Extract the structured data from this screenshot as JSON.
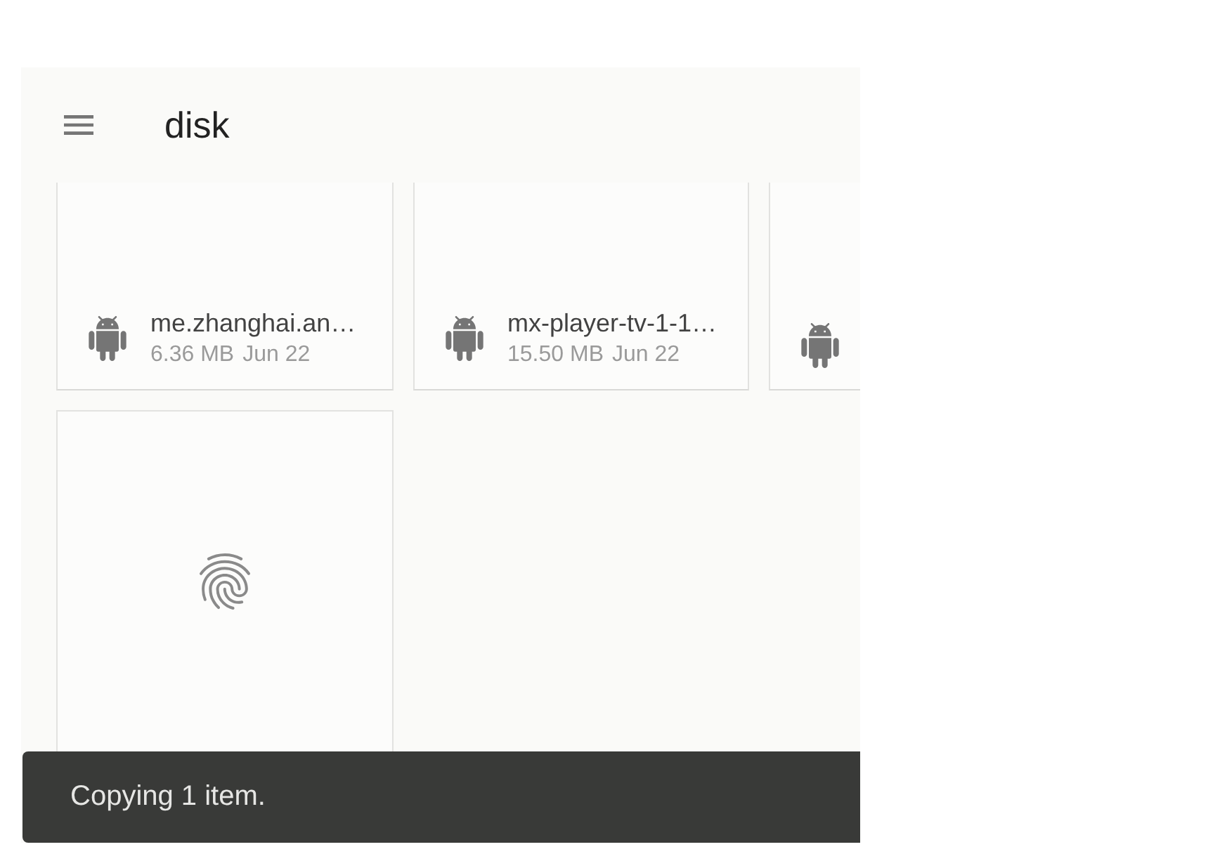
{
  "toolbar": {
    "title": "disk"
  },
  "files": [
    {
      "kind": "apk",
      "name": "me.zhanghai.an…",
      "size": "6.36 MB",
      "date": "Jun 22"
    },
    {
      "kind": "apk",
      "name": "mx-player-tv-1-1…",
      "size": "15.50 MB",
      "date": "Jun 22"
    },
    {
      "kind": "apk"
    },
    {
      "kind": "fingerprint"
    }
  ],
  "snackbar": {
    "message": "Copying 1 item."
  }
}
